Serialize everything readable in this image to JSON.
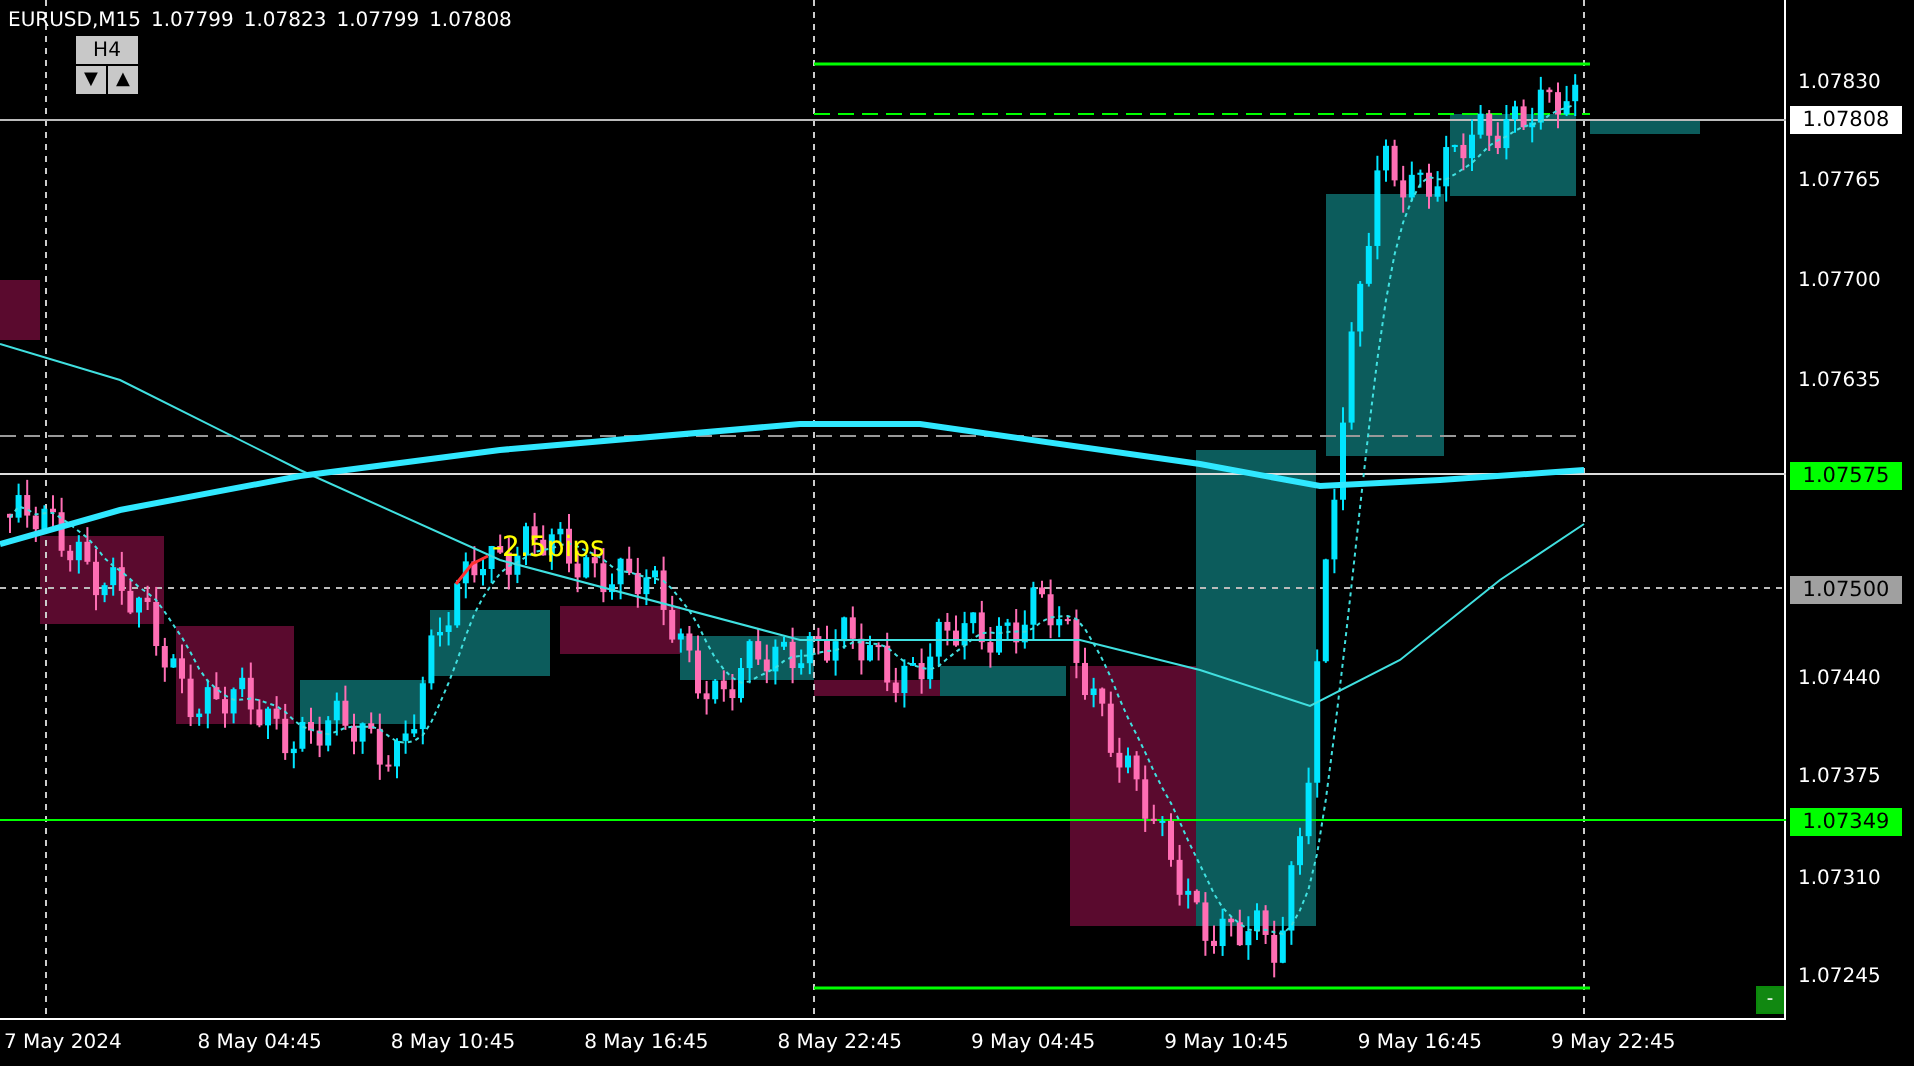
{
  "header": {
    "symbol": "EURUSD,M15",
    "prices": [
      "1.07799",
      "1.07823",
      "1.07799",
      "1.07808"
    ]
  },
  "timeframe_button": {
    "label": "H4"
  },
  "arrow_buttons": [
    "▼",
    "▲"
  ],
  "annotation": "-2.5pips",
  "price_axis": {
    "labels": [
      "1.07830",
      "1.07765",
      "1.07700",
      "1.07635",
      "1.07440",
      "1.07375",
      "1.07310",
      "1.07245"
    ]
  },
  "price_tags": [
    {
      "value": "1.07808",
      "color": "#ffffff"
    },
    {
      "value": "1.07575",
      "color": "#00ff00"
    },
    {
      "value": "1.07500",
      "color": "#a0a0a0"
    },
    {
      "value": "1.07349",
      "color": "#00ff00"
    }
  ],
  "corner_button": {
    "label": "-"
  },
  "time_axis": {
    "labels": [
      "7 May 2024",
      "8 May 04:45",
      "8 May 10:45",
      "8 May 16:45",
      "8 May 22:45",
      "9 May 04:45",
      "9 May 10:45",
      "9 May 16:45",
      "9 May 22:45"
    ]
  }
}
